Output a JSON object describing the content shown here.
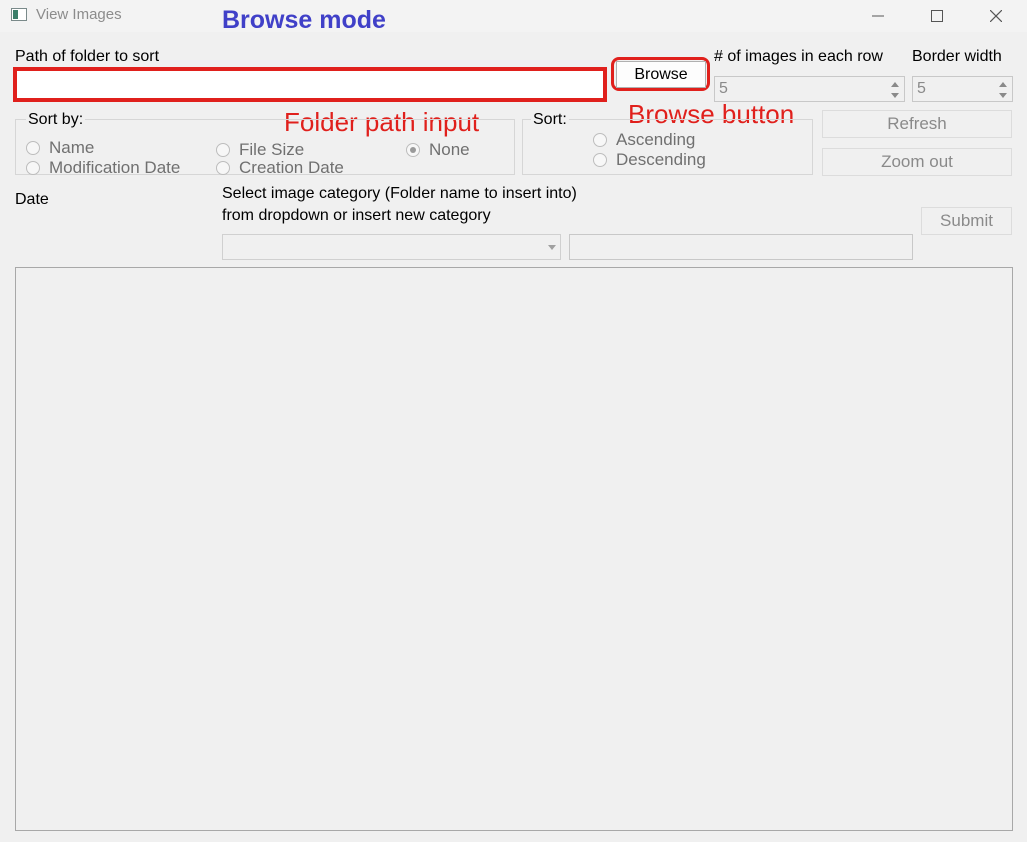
{
  "window": {
    "title": "View Images"
  },
  "annotations": {
    "mode": "Browse mode",
    "folder_input": "Folder path input",
    "browse_button": "Browse button"
  },
  "path": {
    "label": "Path of folder to sort",
    "value": ""
  },
  "browse": {
    "label": "Browse"
  },
  "images_per_row": {
    "label": "# of images in each row",
    "value": "5"
  },
  "border_width": {
    "label": "Border width",
    "value": "5"
  },
  "sort_by": {
    "label": "Sort by:",
    "options": [
      "Name",
      "Modification Date",
      "File Size",
      "Creation Date",
      "None"
    ],
    "selected": "None"
  },
  "sort_order": {
    "label": "Sort:",
    "options": [
      "Ascending",
      "Descending"
    ]
  },
  "buttons": {
    "refresh": "Refresh",
    "zoom_out": "Zoom out",
    "submit": "Submit"
  },
  "date": {
    "label": "Date"
  },
  "category": {
    "label_line1": "Select image category (Folder name to insert into)",
    "label_line2": "from dropdown or insert new category",
    "dropdown_value": "",
    "new_value": ""
  },
  "colors": {
    "annotation_red": "#e0201c",
    "annotation_blue": "#4040c8",
    "window_bg": "#f0f0f0"
  }
}
